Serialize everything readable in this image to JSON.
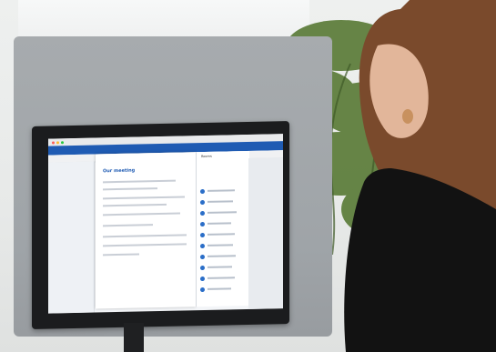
{
  "scene": {
    "screen_texts": {
      "meeting_title": "Our meeting",
      "side_panel_title": "Rooms"
    },
    "colors": {
      "outlook_blue": "#1f5bb3",
      "partition_gray": "#a1a6aa",
      "sweater_black": "#121212",
      "hair_brown": "#7a4a2c",
      "plant_green": "#5f7f3e"
    },
    "icons": [
      "room-avatar-icon",
      "window-control-icon"
    ]
  }
}
